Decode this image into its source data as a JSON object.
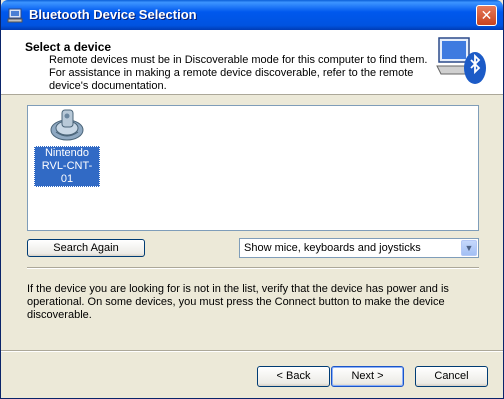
{
  "window": {
    "title": "Bluetooth Device Selection",
    "close_label": "✕"
  },
  "header": {
    "title": "Select a device",
    "subtitle": "Remote devices must be in Discoverable mode for this computer to find them. For assistance in making a remote device discoverable, refer to the remote device's documentation."
  },
  "devices": [
    {
      "name": "Nintendo RVL-CNT-01",
      "icon": "wiimote-device-icon",
      "selected": true
    }
  ],
  "buttons": {
    "search_again": "Search Again",
    "back": "< Back",
    "next": "Next >",
    "cancel": "Cancel"
  },
  "filter": {
    "selected": "Show mice, keyboards and joysticks"
  },
  "note": "If the device you are looking for is not in the list, verify that the device has power and is operational. On some devices, you must press the Connect button to make the device discoverable.",
  "colors": {
    "titlebar": "#0058ee",
    "selection": "#316ac5",
    "dialog_bg": "#ece9d8"
  }
}
